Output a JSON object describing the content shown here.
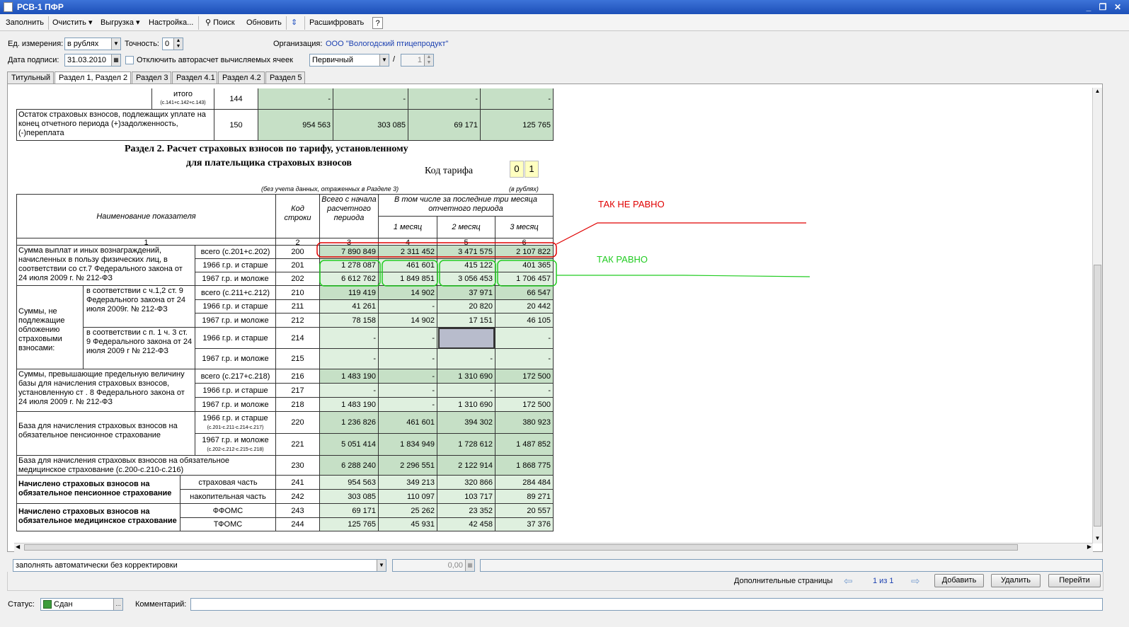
{
  "window": {
    "title": "РСВ-1 ПФР",
    "min": "_",
    "restore": "❐",
    "close": "✕"
  },
  "toolbar": {
    "fill": "Заполнить",
    "clear": "Очистить",
    "export": "Выгрузка",
    "settings": "Настройка...",
    "search": "Поиск",
    "refresh": "Обновить",
    "decode": "Расшифровать",
    "help": "?"
  },
  "params": {
    "unit_label": "Ед. измерения:",
    "unit_value": "в рублях",
    "precision_label": "Точность:",
    "precision_value": "0",
    "org_label": "Организация:",
    "org_value": "ООО \"Вологодский птицепродукт\"",
    "date_label": "Дата подписи:",
    "date_value": "31.03.2010",
    "autocalc_label": "Отключить авторасчет вычисляемых ячеек",
    "type_value": "Первичный",
    "slash": "/",
    "correction_value": "1"
  },
  "tabs": [
    "Титульный",
    "Раздел 1, Раздел 2",
    "Раздел 3",
    "Раздел 4.1",
    "Раздел 4.2",
    "Раздел 5"
  ],
  "top_rows": [
    {
      "label": "итого",
      "sublabel": "(с.141+с.142+с.143)",
      "code": "144",
      "v": [
        "-",
        "-",
        "-",
        "-"
      ]
    },
    {
      "label": "Остаток страховых взносов, подлежащих уплате на конец отчетного периода (+)задолженность, (-)переплата",
      "code": "150",
      "v": [
        "954 563",
        "303 085",
        "69 171",
        "125 765"
      ]
    }
  ],
  "section": {
    "title1": "Раздел 2. Расчет страховых взносов по тарифу, установленному",
    "title2": "для плательщика страховых взносов",
    "tariff_label": "Код тарифа",
    "tariff_d1": "0",
    "tariff_d2": "1",
    "note_left": "(без учета данных, отраженных в Разделе 3)",
    "note_right": "(в рублях)"
  },
  "header": {
    "name": "Наименование показателя",
    "code": "Код строки",
    "total": "Всего с начала расчетного периода",
    "last3": "В том числе за последние три месяца отчетного периода",
    "m1": "1 месяц",
    "m2": "2 месяц",
    "m3": "3 месяц",
    "n1": "1",
    "n2": "2",
    "n3": "3",
    "n4": "4",
    "n5": "5",
    "n6": "6"
  },
  "groups": {
    "g200": "Сумма выплат и иных вознаграждений, начисленных в пользу физических лиц, в соответствии со ст.7 Федерального закона от 24 июля 2009 г. № 212-ФЗ",
    "g210": "Суммы, не подлежащие обложению страховыми взносами:",
    "g210a": "в соответствии с ч.1,2 ст. 9 Федерального закона от 24 июля 2009г. № 212-ФЗ",
    "g214a": "в соответствии с п. 1 ч. 3 ст. 9 Федерального закона от 24 июля 2009 г № 212-ФЗ",
    "g216": "Суммы, превышающие предельную величину базы для начисления страховых взносов, установленную ст . 8 Федерального закона от 24 июля 2009 г. № 212-ФЗ",
    "g220": "База для начисления страховых взносов на обязательное пенсионное страхование",
    "g230": "База для начисления страховых взносов на обязательное медицинское страхование (с.200-с.210-с.216)",
    "g241": "Начислено страховых взносов на обязательное пенсионное страхование",
    "g243": "Начислено страховых взносов на обязательное медицинское страхование"
  },
  "rows": [
    {
      "sub": "всего (с.201+с.202)",
      "code": "200",
      "v": [
        "7 890 849",
        "2 311 452",
        "3 471 575",
        "2 107 822"
      ]
    },
    {
      "sub": "1966 г.р. и старше",
      "code": "201",
      "v": [
        "1 278 087",
        "461 601",
        "415 122",
        "401 365"
      ]
    },
    {
      "sub": "1967 г.р. и моложе",
      "code": "202",
      "v": [
        "6 612 762",
        "1 849 851",
        "3 056 453",
        "1 706 457"
      ]
    },
    {
      "sub": "всего (с.211+с.212)",
      "code": "210",
      "v": [
        "119 419",
        "14 902",
        "37 971",
        "66 547"
      ]
    },
    {
      "sub": "1966 г.р. и старше",
      "code": "211",
      "v": [
        "41 261",
        "-",
        "20 820",
        "20 442"
      ]
    },
    {
      "sub": "1967 г.р. и моложе",
      "code": "212",
      "v": [
        "78 158",
        "14 902",
        "17 151",
        "46 105"
      ]
    },
    {
      "sub": "1966 г.р. и старше",
      "code": "214",
      "v": [
        "-",
        "-",
        "",
        "-"
      ]
    },
    {
      "sub": "1967 г.р. и моложе",
      "code": "215",
      "v": [
        "-",
        "-",
        "-",
        "-"
      ]
    },
    {
      "sub": "всего (с.217+с.218)",
      "code": "216",
      "v": [
        "1 483 190",
        "-",
        "1 310 690",
        "172 500"
      ]
    },
    {
      "sub": "1966 г.р. и старше",
      "code": "217",
      "v": [
        "-",
        "-",
        "-",
        "-"
      ]
    },
    {
      "sub": "1967 г.р. и моложе",
      "code": "218",
      "v": [
        "1 483 190",
        "-",
        "1 310 690",
        "172 500"
      ]
    },
    {
      "sub": "1966 г.р. и старше",
      "subnote": "(с.201-с.211-с.214-с.217)",
      "code": "220",
      "v": [
        "1 236 826",
        "461 601",
        "394 302",
        "380 923"
      ]
    },
    {
      "sub": "1967 г.р. и моложе",
      "subnote": "(с.202-с.212-с.215-с.218)",
      "code": "221",
      "v": [
        "5 051 414",
        "1 834 949",
        "1 728 612",
        "1 487 852"
      ]
    },
    {
      "sub": "",
      "code": "230",
      "v": [
        "6 288 240",
        "2 296 551",
        "2 122 914",
        "1 868 775"
      ]
    },
    {
      "sub": "страховая часть",
      "code": "241",
      "v": [
        "954 563",
        "349 213",
        "320 866",
        "284 484"
      ]
    },
    {
      "sub": "накопительная часть",
      "code": "242",
      "v": [
        "303 085",
        "110 097",
        "103 717",
        "89 271"
      ]
    },
    {
      "sub": "ФФОМС",
      "code": "243",
      "v": [
        "69 171",
        "25 262",
        "23 352",
        "20 557"
      ]
    },
    {
      "sub": "ТФОМС",
      "code": "244",
      "v": [
        "125 765",
        "45 931",
        "42 458",
        "37 376"
      ]
    }
  ],
  "annotations": {
    "not_equal": "ТАК НЕ РАВНО",
    "equal": "ТАК РАВНО",
    "red": "#e00000",
    "green": "#22cc22"
  },
  "bottom": {
    "mode": "заполнять автоматически без корректировки",
    "amount": "0,00",
    "extra_pages": "Дополнительные страницы",
    "pager": "1 из 1",
    "add": "Добавить",
    "delete": "Удалить",
    "go": "Перейти"
  },
  "status": {
    "label": "Статус:",
    "value": "Сдан",
    "comment_label": "Комментарий:"
  }
}
